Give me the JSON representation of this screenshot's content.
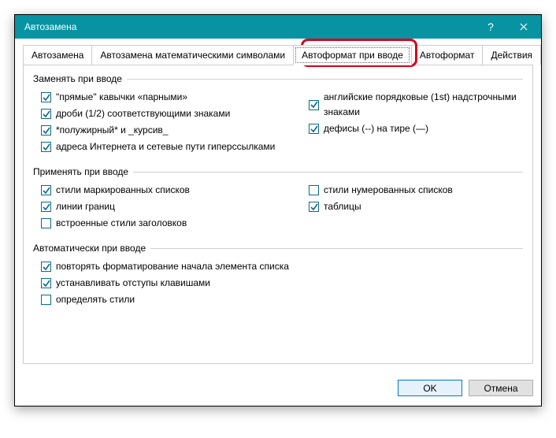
{
  "window": {
    "title": "Автозамена"
  },
  "tabs": [
    {
      "label": "Автозамена"
    },
    {
      "label": "Автозамена математическими символами"
    },
    {
      "label": "Автоформат при вводе"
    },
    {
      "label": "Автоформат"
    },
    {
      "label": "Действия"
    }
  ],
  "group1": {
    "title": "Заменять при вводе",
    "left": [
      {
        "label": "\"прямые\" кавычки «парными»",
        "checked": true
      },
      {
        "label": "дроби (1/2) соответствующими знаками",
        "checked": true
      },
      {
        "label": "*полужирный* и _курсив_",
        "checked": true
      },
      {
        "label": "адреса Интернета и сетевые пути гиперссылками",
        "checked": true
      }
    ],
    "right": [
      {
        "label": "английские порядковые (1st) надстрочными знаками",
        "checked": true
      },
      {
        "label": "дефисы (--) на тире (—)",
        "checked": true
      }
    ]
  },
  "group2": {
    "title": "Применять при вводе",
    "left": [
      {
        "label": "стили маркированных списков",
        "checked": true
      },
      {
        "label": "линии границ",
        "checked": true
      },
      {
        "label": "встроенные стили заголовков",
        "checked": false
      }
    ],
    "right": [
      {
        "label": "стили нумерованных списков",
        "checked": false
      },
      {
        "label": "таблицы",
        "checked": true
      }
    ]
  },
  "group3": {
    "title": "Автоматически при вводе",
    "items": [
      {
        "label": "повторять форматирование начала элемента списка",
        "checked": true
      },
      {
        "label": "устанавливать отступы клавишами",
        "checked": true
      },
      {
        "label": "определять стили",
        "checked": false
      }
    ]
  },
  "buttons": {
    "ok": "OK",
    "cancel": "Отмена"
  }
}
